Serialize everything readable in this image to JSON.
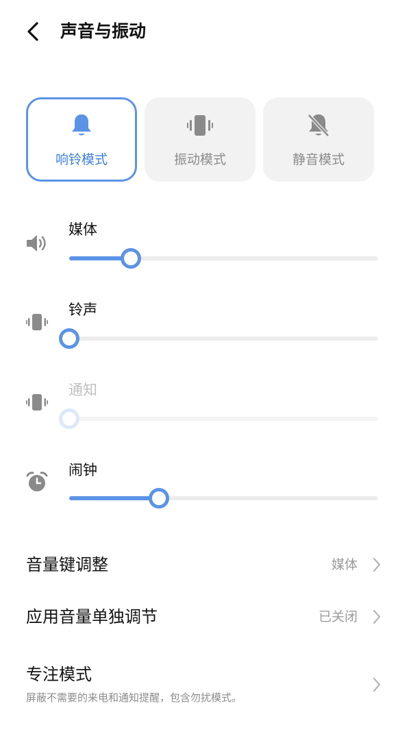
{
  "header": {
    "title": "声音与振动",
    "back_icon": "back-arrow-icon"
  },
  "modes": [
    {
      "label": "响铃模式",
      "icon": "bell-icon",
      "active": true
    },
    {
      "label": "振动模式",
      "icon": "vibrate-icon",
      "active": false
    },
    {
      "label": "静音模式",
      "icon": "bell-off-icon",
      "active": false
    }
  ],
  "volumes": [
    {
      "label": "媒体",
      "icon": "speaker-icon",
      "level_fraction": 0.2,
      "enabled": true
    },
    {
      "label": "铃声",
      "icon": "vibrate-icon",
      "level_fraction": 0.0,
      "enabled": true
    },
    {
      "label": "通知",
      "icon": "vibrate-icon",
      "level_fraction": 0.0,
      "enabled": false
    },
    {
      "label": "闹钟",
      "icon": "alarm-clock-icon",
      "level_fraction": 0.29,
      "enabled": true
    }
  ],
  "settings": {
    "volume_key": {
      "label": "音量键调整",
      "value": "媒体"
    },
    "app_volume": {
      "label": "应用音量单独调节",
      "value": "已关闭"
    },
    "focus": {
      "label": "专注模式",
      "subtitle": "屏蔽不需要的来电和通知提醒，包含勿扰模式。"
    }
  },
  "colors": {
    "accent": "#5b93e6",
    "accent_text": "#3d7fdc",
    "icon_gray": "#8a8a8a",
    "disabled": "#bfbfbf"
  }
}
